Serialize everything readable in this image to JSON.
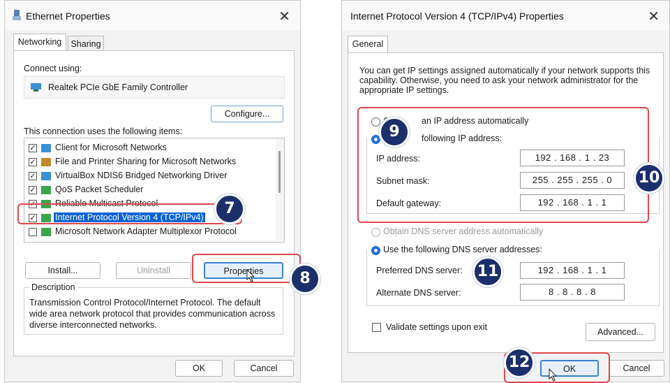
{
  "left_dialog": {
    "title": "Ethernet Properties",
    "close_glyph": "✕",
    "tabs": [
      "Networking",
      "Sharing"
    ],
    "connect_using_label": "Connect using:",
    "adapter_name": "Realtek PCIe GbE Family Controller",
    "configure_label": "Configure...",
    "items_label": "This connection uses the following items:",
    "items": [
      {
        "label": "Client for Microsoft Networks",
        "checked": true
      },
      {
        "label": "File and Printer Sharing for Microsoft Networks",
        "checked": true
      },
      {
        "label": "VirtualBox NDIS6 Bridged Networking Driver",
        "checked": true
      },
      {
        "label": "QoS Packet Scheduler",
        "checked": true
      },
      {
        "label": "Reliable Multicast Protocol",
        "checked": true
      },
      {
        "label": "Internet Protocol Version 4 (TCP/IPv4)",
        "checked": true,
        "selected": true
      },
      {
        "label": "Microsoft Network Adapter Multiplexor Protocol",
        "checked": false
      }
    ],
    "install_label": "Install...",
    "uninstall_label": "Uninstall",
    "properties_label": "Properties",
    "description_label": "Description",
    "description_text": "Transmission Control Protocol/Internet Protocol. The default wide area network protocol that provides communication across diverse interconnected networks.",
    "ok_label": "OK",
    "cancel_label": "Cancel"
  },
  "right_dialog": {
    "title": "Internet Protocol Version 4 (TCP/IPv4) Properties",
    "close_glyph": "✕",
    "tabs": [
      "General"
    ],
    "intro_text": "You can get IP settings assigned automatically if your network supports this capability. Otherwise, you need to ask your network administrator for the appropriate IP settings.",
    "obtain_ip_label": "an IP address automatically",
    "obtain_ip_prefix": "O",
    "use_ip_label": "following IP address:",
    "ip_label": "IP address:",
    "ip_value": "192  .  168  .  1  .  23",
    "subnet_label": "Subnet mask:",
    "subnet_value": "255  .  255  .  255  .  0",
    "gateway_label": "Default gateway:",
    "gateway_value": "192  .  168  .  1  .  1",
    "obtain_dns_label": "Obtain DNS server address automatically",
    "use_dns_label": "Use the following DNS server addresses:",
    "preferred_dns_label": "Preferred DNS server:",
    "preferred_dns_value": "192  .  168  .  1  .  1",
    "alternate_dns_label": "Alternate DNS server:",
    "alternate_dns_value": "8  .  8  .  8  .  8",
    "validate_label": "Validate settings upon exit",
    "advanced_label": "Advanced...",
    "ok_label": "OK",
    "cancel_label": "Cancel"
  },
  "step_badges": [
    "7",
    "8",
    "9",
    "10",
    "11",
    "12"
  ],
  "colors": {
    "badge": "#1b2f6b",
    "highlight": "#e0474c",
    "selection": "#0a64d6",
    "accent": "#1f6fd0"
  },
  "icons": [
    "network-adapter-icon",
    "network-component-icon",
    "cursor-pointer-icon"
  ]
}
